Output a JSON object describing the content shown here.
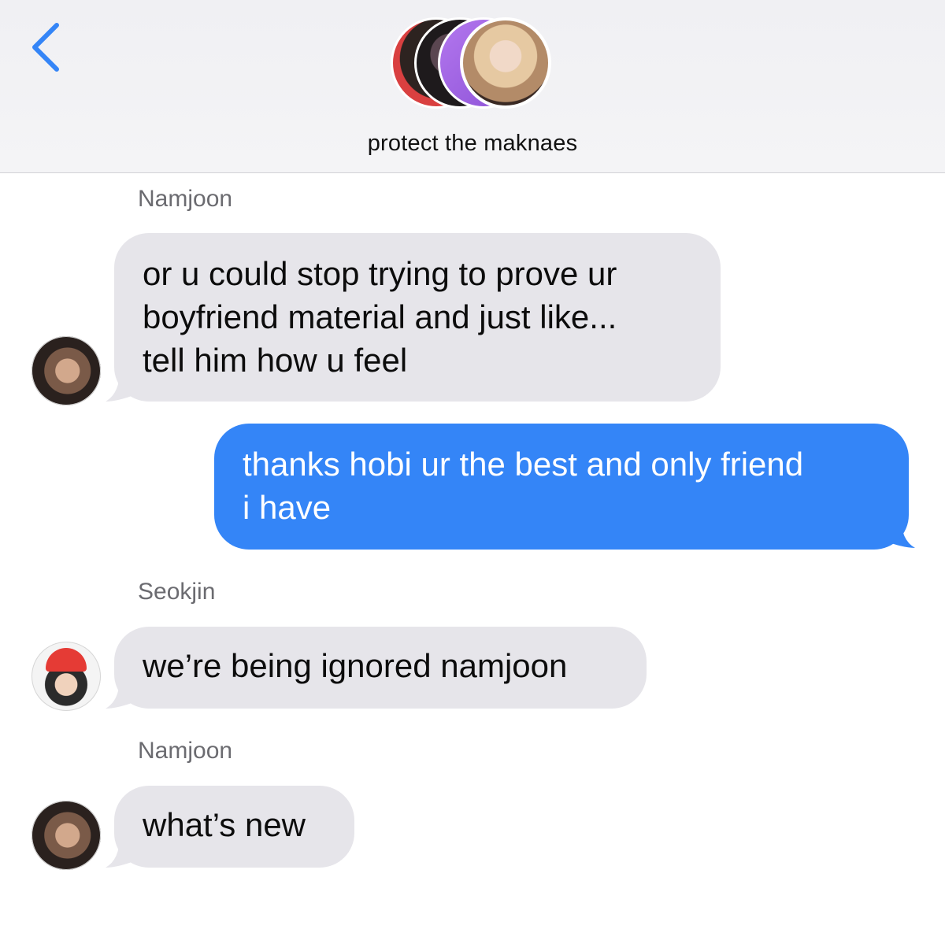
{
  "header": {
    "group_name": "protect the maknaes",
    "back_label": "back",
    "accent_color": "#3485f7"
  },
  "messages": [
    {
      "sender": "Namjoon",
      "text_lines": [
        "or u could stop trying to prove ur",
        "boyfriend material and just like...",
        "tell him how u feel"
      ],
      "direction": "incoming"
    },
    {
      "sender": "",
      "text_lines": [
        "thanks hobi ur the best and only friend",
        "i have"
      ],
      "direction": "outgoing"
    },
    {
      "sender": "Seokjin",
      "text_lines": [
        "we’re being ignored namjoon"
      ],
      "direction": "incoming"
    },
    {
      "sender": "Namjoon",
      "text_lines": [
        "what’s new"
      ],
      "direction": "incoming"
    }
  ],
  "colors": {
    "incoming_bubble": "#e6e5ea",
    "outgoing_bubble": "#3485f7",
    "sender_label": "#6b6b70"
  }
}
